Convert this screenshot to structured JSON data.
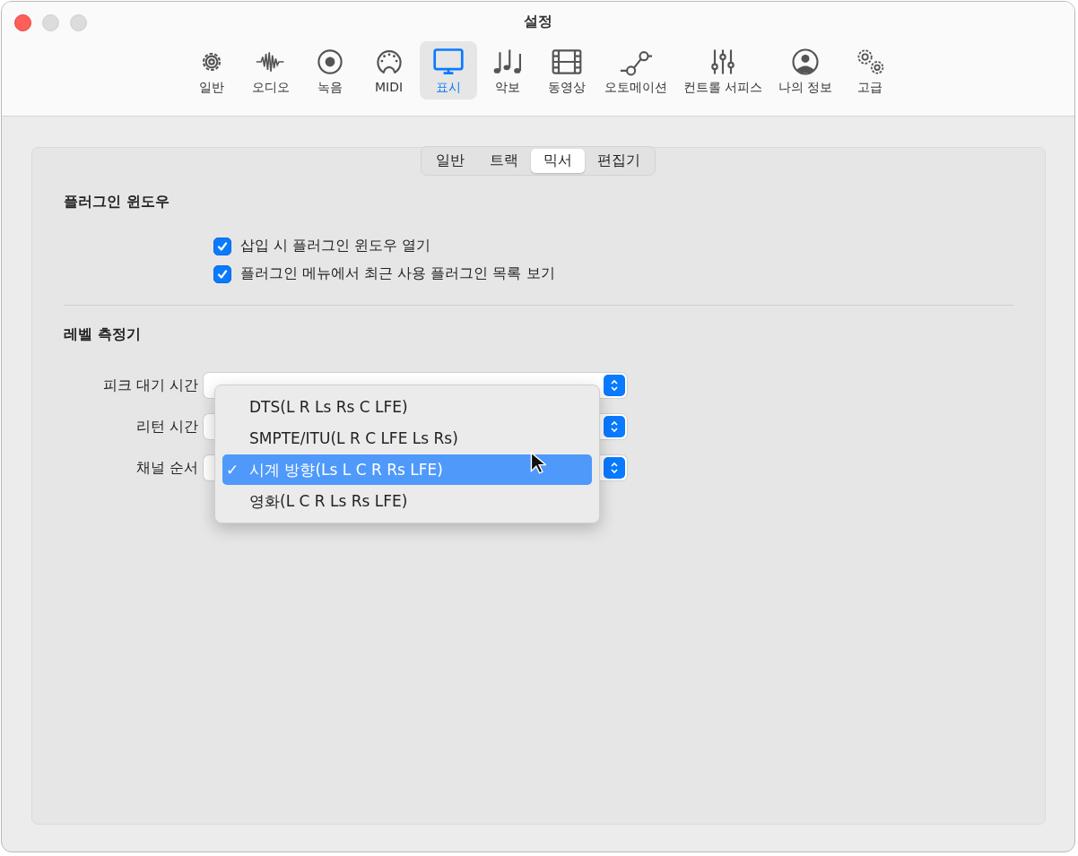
{
  "window": {
    "title": "설정"
  },
  "toolbar": [
    {
      "label": "일반",
      "selected": false
    },
    {
      "label": "오디오",
      "selected": false
    },
    {
      "label": "녹음",
      "selected": false
    },
    {
      "label": "MIDI",
      "selected": false
    },
    {
      "label": "표시",
      "selected": true
    },
    {
      "label": "악보",
      "selected": false
    },
    {
      "label": "동영상",
      "selected": false
    },
    {
      "label": "오토메이션",
      "selected": false
    },
    {
      "label": "컨트롤 서피스",
      "selected": false
    },
    {
      "label": "나의 정보",
      "selected": false
    },
    {
      "label": "고급",
      "selected": false
    }
  ],
  "tabs": [
    {
      "label": "일반",
      "selected": false
    },
    {
      "label": "트랙",
      "selected": false
    },
    {
      "label": "믹서",
      "selected": true
    },
    {
      "label": "편집기",
      "selected": false
    }
  ],
  "plugin_section": {
    "title": "플러그인 윈도우",
    "options": [
      {
        "label": "삽입 시 플러그인 윈도우 열기",
        "checked": true
      },
      {
        "label": "플러그인 메뉴에서 최근 사용 플러그인 목록 보기",
        "checked": true
      }
    ]
  },
  "meter_section": {
    "title": "레벨 측정기",
    "fields": [
      {
        "label": "피크 대기 시간"
      },
      {
        "label": "리턴 시간"
      },
      {
        "label": "채널 순서"
      }
    ]
  },
  "menu": {
    "items": [
      {
        "label": "DTS(L R Ls Rs C LFE)",
        "selected": false
      },
      {
        "label": "SMPTE/ITU(L R C LFE Ls Rs)",
        "selected": false
      },
      {
        "label": "시계 방향(Ls L C R Rs LFE)",
        "selected": true
      },
      {
        "label": "영화(L C R Ls Rs LFE)",
        "selected": false
      }
    ],
    "check": "✓"
  }
}
